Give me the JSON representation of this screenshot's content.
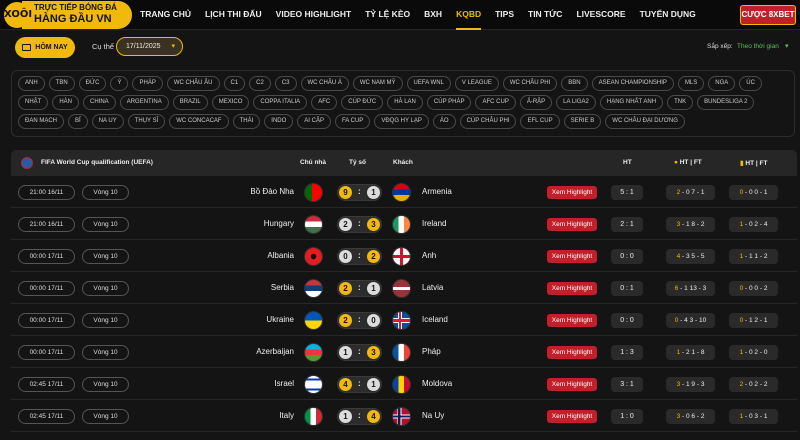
{
  "header": {
    "logo_line1": "TRỰC TIẾP BÓNG ĐÁ",
    "logo_line2": "HÀNG ĐẦU VN",
    "logo_badge": "XOÔI",
    "nav": [
      {
        "label": "TRANG CHỦ",
        "active": false
      },
      {
        "label": "LỊCH THI ĐẤU",
        "active": false
      },
      {
        "label": "VIDEO HIGHLIGHT",
        "active": false
      },
      {
        "label": "TỶ LỆ KÈO",
        "active": false
      },
      {
        "label": "BXH",
        "active": false
      },
      {
        "label": "KQBD",
        "active": true
      },
      {
        "label": "TIPS",
        "active": false
      },
      {
        "label": "TIN TỨC",
        "active": false
      },
      {
        "label": "LIVESCORE",
        "active": false
      },
      {
        "label": "TUYỂN DỤNG",
        "active": false
      }
    ],
    "cta_label": "CƯỢC 8XBET"
  },
  "filters": {
    "today_label": "HÔM NAY",
    "specific_label": "Cụ thể",
    "date_value": "17/11/2025",
    "sort_label": "Sắp xếp:",
    "sort_value": "Theo thời gian"
  },
  "leagues": [
    "ANH",
    "TBN",
    "ĐỨC",
    "Ý",
    "PHÁP",
    "WC CHÂU ÂU",
    "C1",
    "C2",
    "C3",
    "WC CHÂU Á",
    "WC NAM MỸ",
    "UEFA WNL",
    "V LEAGUE",
    "WC CHÂU PHI",
    "BBN",
    "ASEAN CHAMPIONSHIP",
    "MLS",
    "NGA",
    "ÚC",
    "NHẬT",
    "HÀN",
    "CHINA",
    "ARGENTINA",
    "BRAZIL",
    "MEXICO",
    "COPPA ITALIA",
    "AFC",
    "CÚP ĐỨC",
    "HÀ LAN",
    "CÚP PHÁP",
    "AFC CUP",
    "Ả-RẬP",
    "LA LIGA2",
    "HẠNG NHẤT ANH",
    "TNK",
    "BUNDESLIGA 2",
    "ĐAN MẠCH",
    "BỈ",
    "NA UY",
    "THỤY SĨ",
    "WC CONCACAF",
    "THÁI",
    "INDO",
    "AI CẬP",
    "FA CUP",
    "VĐQG HY LẠP",
    "ÁO",
    "CÚP CHÂU PHI",
    "EFL CUP",
    "SERIE B",
    "WC CHÂU ĐẠI DƯƠNG"
  ],
  "table": {
    "league_name": "FIFA World Cup qualification (UEFA)",
    "col_home": "Chủ nhà",
    "col_score": "Tỷ số",
    "col_away": "Khách",
    "col_ht": "HT",
    "col_ht_ft1": "HT | FT",
    "col_ht_ft2": "HT | FT",
    "highlight_label": "Xem Highlight",
    "matches": [
      {
        "time": "21:00 16/11",
        "round": "Vòng 10",
        "home": "Bồ Đào Nha",
        "home_flag": "portugal",
        "home_score": "9",
        "away_score": "1",
        "away": "Armenia",
        "away_flag": "armenia",
        "ht": "5 : 1",
        "c1": [
          "2",
          "0",
          "7",
          "1"
        ],
        "c2": [
          "0",
          "0",
          "0",
          "1"
        ]
      },
      {
        "time": "21:00 16/11",
        "round": "Vòng 10",
        "home": "Hungary",
        "home_flag": "hungary",
        "home_score": "2",
        "away_score": "3",
        "away": "Ireland",
        "away_flag": "ireland",
        "ht": "2 : 1",
        "c1": [
          "3",
          "1",
          "8",
          "2"
        ],
        "c2": [
          "1",
          "0",
          "2",
          "4"
        ]
      },
      {
        "time": "00:00 17/11",
        "round": "Vòng 10",
        "home": "Albania",
        "home_flag": "albania",
        "home_score": "0",
        "away_score": "2",
        "away": "Anh",
        "away_flag": "england",
        "ht": "0 : 0",
        "c1": [
          "4",
          "3",
          "5",
          "5"
        ],
        "c2": [
          "1",
          "1",
          "1",
          "2"
        ]
      },
      {
        "time": "00:00 17/11",
        "round": "Vòng 10",
        "home": "Serbia",
        "home_flag": "serbia",
        "home_score": "2",
        "away_score": "1",
        "away": "Latvia",
        "away_flag": "latvia",
        "ht": "0 : 1",
        "c1": [
          "6",
          "1",
          "13",
          "3"
        ],
        "c2": [
          "0",
          "0",
          "0",
          "2"
        ]
      },
      {
        "time": "00:00 17/11",
        "round": "Vòng 10",
        "home": "Ukraine",
        "home_flag": "ukraine",
        "home_score": "2",
        "away_score": "0",
        "away": "Iceland",
        "away_flag": "iceland",
        "ht": "0 : 0",
        "c1": [
          "0",
          "4",
          "3",
          "10"
        ],
        "c2": [
          "0",
          "1",
          "2",
          "1"
        ]
      },
      {
        "time": "00:00 17/11",
        "round": "Vòng 10",
        "home": "Azerbaijan",
        "home_flag": "azerbaijan",
        "home_score": "1",
        "away_score": "3",
        "away": "Pháp",
        "away_flag": "france",
        "ht": "1 : 3",
        "c1": [
          "1",
          "2",
          "1",
          "8"
        ],
        "c2": [
          "1",
          "0",
          "2",
          "0"
        ]
      },
      {
        "time": "02:45 17/11",
        "round": "Vòng 10",
        "home": "Israel",
        "home_flag": "israel",
        "home_score": "4",
        "away_score": "1",
        "away": "Moldova",
        "away_flag": "moldova",
        "ht": "3 : 1",
        "c1": [
          "3",
          "1",
          "9",
          "3"
        ],
        "c2": [
          "2",
          "0",
          "2",
          "2"
        ]
      },
      {
        "time": "02:45 17/11",
        "round": "Vòng 10",
        "home": "Italy",
        "home_flag": "italy",
        "home_score": "1",
        "away_score": "4",
        "away": "Na Uy",
        "away_flag": "norway",
        "ht": "1 : 0",
        "c1": [
          "3",
          "0",
          "6",
          "2"
        ],
        "c2": [
          "1",
          "0",
          "3",
          "1"
        ]
      }
    ]
  }
}
